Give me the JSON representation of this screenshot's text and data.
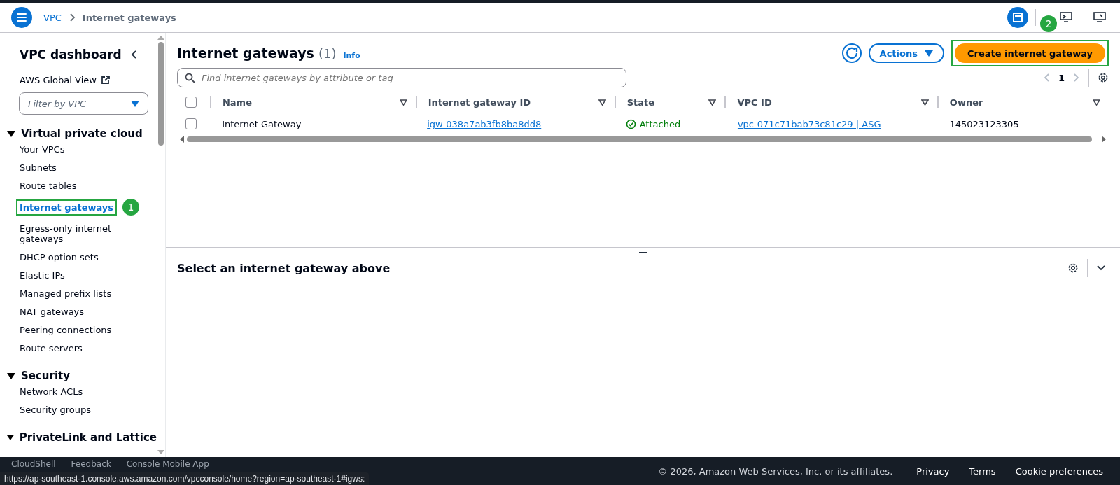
{
  "breadcrumb": [
    {
      "label": "VPC"
    },
    {
      "label": "Internet gateways"
    }
  ],
  "sidebar": {
    "title": "VPC dashboard",
    "global_view": "AWS Global View",
    "filter": {
      "placeholder": "Filter by VPC"
    },
    "sections": [
      {
        "title": "Virtual private cloud",
        "expanded": true,
        "items": [
          {
            "label": "Your VPCs",
            "selected": false
          },
          {
            "label": "Subnets",
            "selected": false
          },
          {
            "label": "Route tables",
            "selected": false
          },
          {
            "label": "Internet gateways",
            "selected": true,
            "badge": "1"
          },
          {
            "label": "Egress-only internet gateways",
            "selected": false
          },
          {
            "label": "DHCP option sets",
            "selected": false
          },
          {
            "label": "Elastic IPs",
            "selected": false
          },
          {
            "label": "Managed prefix lists",
            "selected": false
          },
          {
            "label": "NAT gateways",
            "selected": false
          },
          {
            "label": "Peering connections",
            "selected": false
          },
          {
            "label": "Route servers",
            "selected": false
          }
        ]
      },
      {
        "title": "Security",
        "expanded": true,
        "items": [
          {
            "label": "Network ACLs",
            "selected": false
          },
          {
            "label": "Security groups",
            "selected": false
          }
        ]
      },
      {
        "title": "PrivateLink and Lattice",
        "expanded": true
      }
    ]
  },
  "panel": {
    "title": "Internet gateways",
    "count": "(1)",
    "info": "Info",
    "actions": "Actions",
    "create": "Create internet gateway",
    "create_badge": "2",
    "search": {
      "placeholder": "Find internet gateways by attribute or tag"
    },
    "page": "1",
    "table": {
      "select_all_checked": false,
      "columns": [
        "Name",
        "Internet gateway ID",
        "State",
        "VPC ID",
        "Owner"
      ],
      "rows": [
        {
          "checked": false,
          "name": "Internet Gateway",
          "id": "igw-038a7ab3fb8ba8dd8",
          "state": "Attached",
          "vpc": "vpc-071c71bab73c81c29 | ASG",
          "owner": "145023123305"
        }
      ]
    }
  },
  "details": {
    "title": "Select an internet gateway above"
  },
  "footer": {
    "items": [
      "CloudShell",
      "Feedback",
      "Console Mobile App"
    ],
    "copyright": "© 2026, Amazon Web Services, Inc. or its affiliates.",
    "links": [
      "Privacy",
      "Terms",
      "Cookie preferences"
    ]
  },
  "status_url": "https://ap-southeast-1.console.aws.amazon.com/vpcconsole/home?region=ap-southeast-1#igws:"
}
